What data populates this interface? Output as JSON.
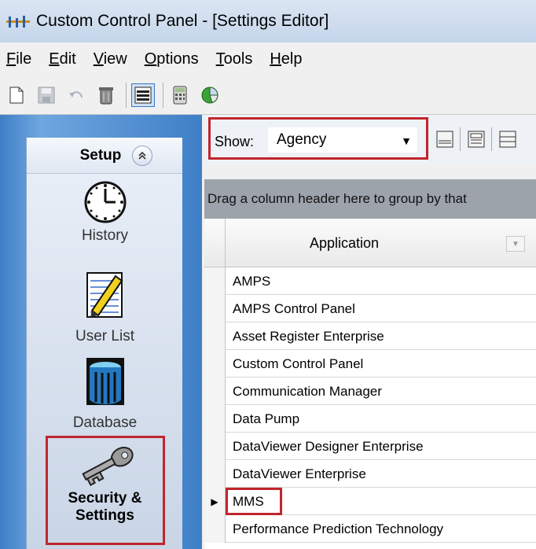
{
  "window": {
    "title": "Custom Control Panel - [Settings Editor]"
  },
  "menu": [
    {
      "label": "File",
      "key": "F",
      "rest": "ile"
    },
    {
      "label": "Edit",
      "key": "E",
      "rest": "dit"
    },
    {
      "label": "View",
      "key": "V",
      "rest": "iew"
    },
    {
      "label": "Options",
      "key": "O",
      "rest": "ptions"
    },
    {
      "label": "Tools",
      "key": "T",
      "rest": "ools"
    },
    {
      "label": "Help",
      "key": "H",
      "rest": "elp"
    }
  ],
  "toolbar": {
    "icons": [
      "new-document-icon",
      "save-icon",
      "undo-icon",
      "recycle-bin-icon",
      "list-view-icon",
      "calculator-icon",
      "pie-chart-icon"
    ]
  },
  "sidebar": {
    "header": "Setup",
    "items": [
      {
        "label": "History",
        "icon": "clock-icon"
      },
      {
        "label": "User List",
        "icon": "notepad-pencil-icon"
      },
      {
        "label": "Database",
        "icon": "database-icon"
      },
      {
        "label_line1": "Security &",
        "label_line2": "Settings",
        "icon": "key-icon",
        "selected": true
      }
    ]
  },
  "show": {
    "label": "Show:",
    "value": "Agency"
  },
  "grid": {
    "group_hint": "Drag a column header here to group by that",
    "column": "Application",
    "rows": [
      "AMPS",
      "AMPS Control Panel",
      "Asset Register Enterprise",
      "Custom Control Panel",
      "Communication Manager",
      "Data Pump",
      "DataViewer Designer Enterprise",
      "DataViewer Enterprise",
      "MMS",
      "Performance Prediction Technology"
    ],
    "current_row": "MMS"
  },
  "colors": {
    "highlight": "#c0262c",
    "sidebar_blue": "#3f7fc7"
  }
}
